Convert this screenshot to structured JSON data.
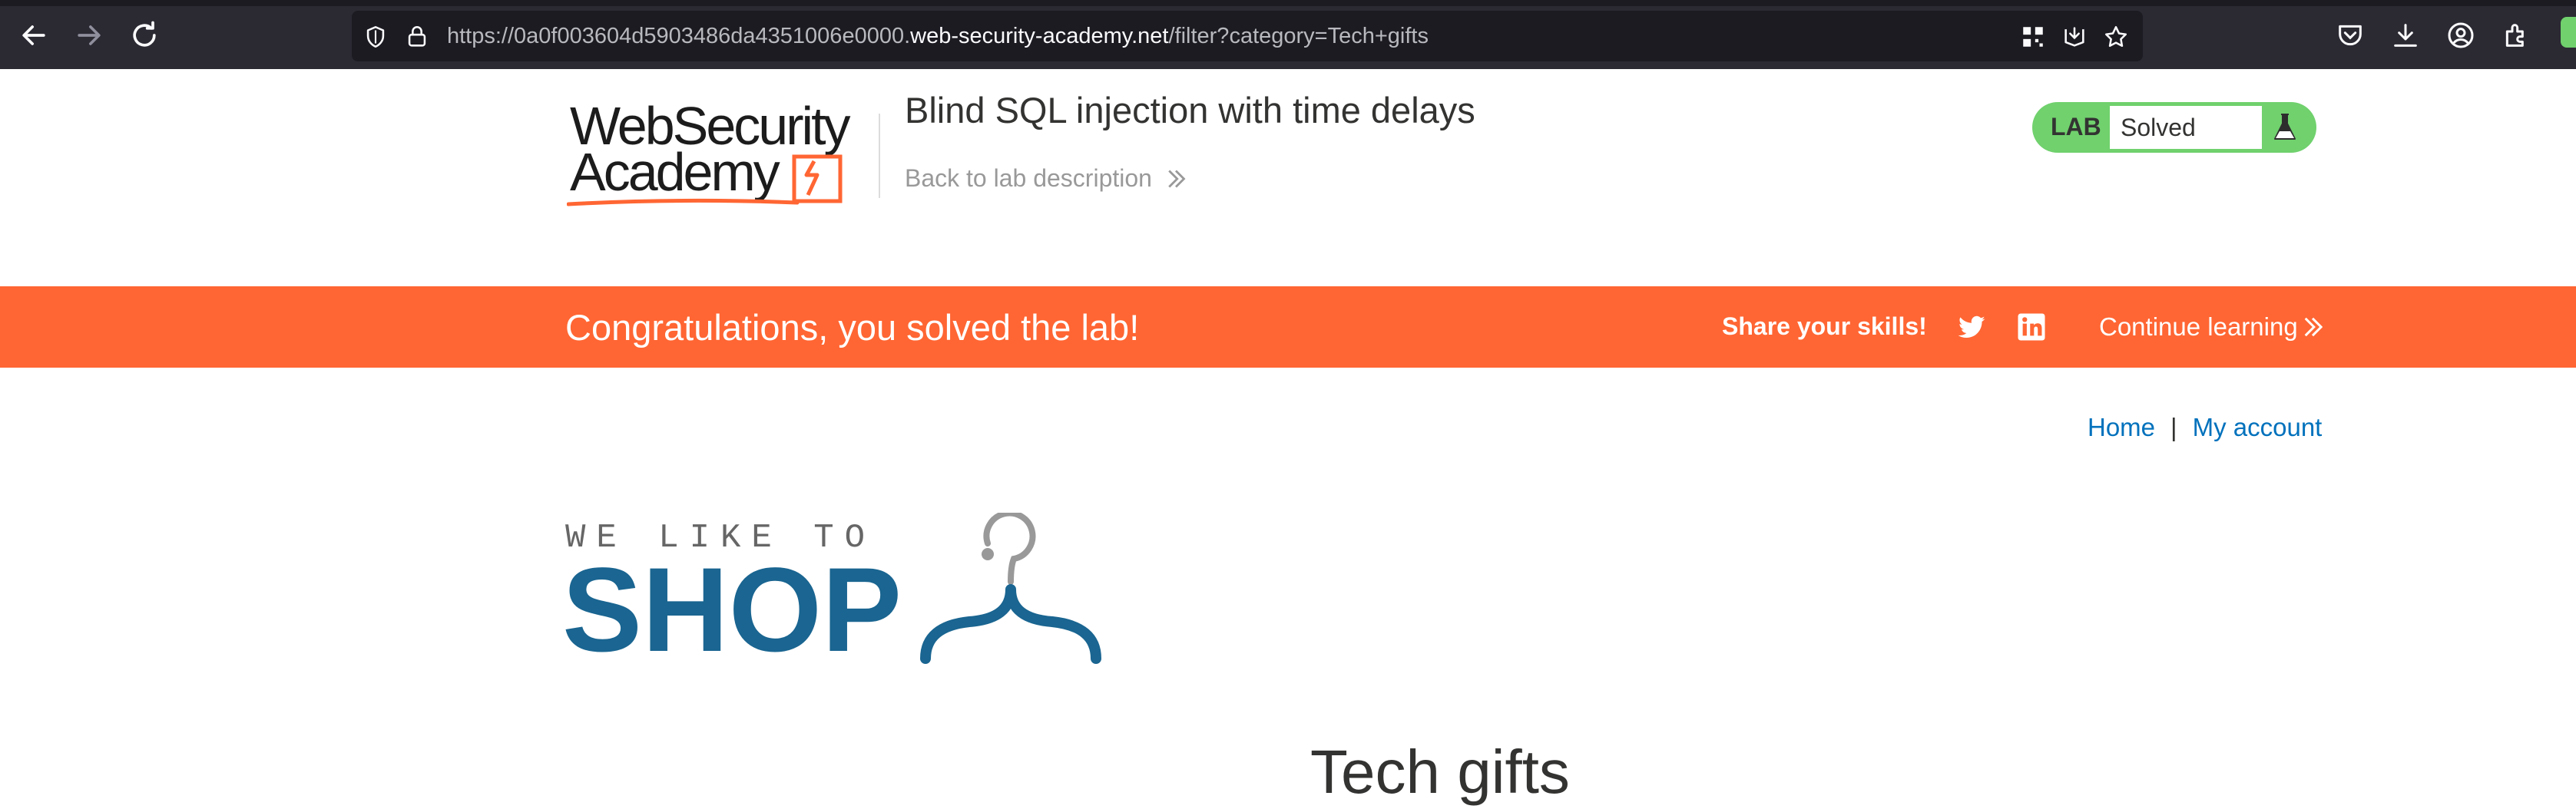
{
  "browser": {
    "url_prefix": "https://0a0f003604d5903486da4351006e0000.",
    "url_host": "web-security-academy.net",
    "url_path": "/filter?category=Tech+gifts",
    "icons": {
      "back": "back-arrow-icon",
      "forward": "forward-arrow-icon",
      "reload": "reload-icon",
      "tracking_protection": "shield-icon",
      "security": "lock-icon",
      "qr": "qr-code-icon",
      "reader": "reader-view-icon",
      "bookmark": "star-icon",
      "pocket": "pocket-icon",
      "downloads": "download-icon",
      "account": "account-icon",
      "extensions": "extensions-icon"
    }
  },
  "lab": {
    "logo_line1": "WebSecurity",
    "logo_line2": "Academy",
    "title": "Blind SQL injection with time delays",
    "back_link": "Back to lab description",
    "badge_label": "LAB",
    "status": "Solved",
    "accent_color": "#70d16d"
  },
  "banner": {
    "message": "Congratulations, you solved the lab!",
    "share_label": "Share your skills!",
    "continue_label": "Continue learning",
    "color": "#ff6633"
  },
  "nav": {
    "home": "Home",
    "separator": "|",
    "my_account": "My account"
  },
  "shop": {
    "tagline": "WE LIKE TO",
    "name": "SHOP",
    "brand_color": "#1a6591"
  },
  "page": {
    "heading": "Tech gifts"
  }
}
